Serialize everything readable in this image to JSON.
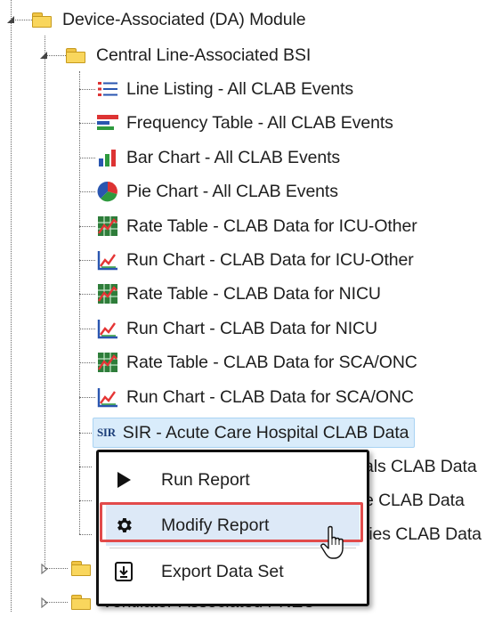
{
  "tree": {
    "da_module": "Device-Associated (DA) Module",
    "clab_folder": "Central Line-Associated BSI",
    "reports": [
      {
        "label": "Line Listing - All CLAB Events",
        "icon": "line-listing-icon"
      },
      {
        "label": "Frequency Table - All CLAB Events",
        "icon": "frequency-table-icon"
      },
      {
        "label": "Bar Chart - All CLAB Events",
        "icon": "bar-chart-icon"
      },
      {
        "label": "Pie Chart - All CLAB Events",
        "icon": "pie-chart-icon"
      },
      {
        "label": "Rate Table - CLAB Data for ICU-Other",
        "icon": "rate-table-icon"
      },
      {
        "label": "Run Chart - CLAB Data for ICU-Other",
        "icon": "run-chart-icon"
      },
      {
        "label": "Rate Table - CLAB Data for NICU",
        "icon": "rate-table-icon"
      },
      {
        "label": "Run Chart - CLAB Data for NICU",
        "icon": "run-chart-icon"
      },
      {
        "label": "Rate Table - CLAB Data for SCA/ONC",
        "icon": "rate-table-icon"
      },
      {
        "label": "Run Chart - CLAB Data for SCA/ONC",
        "icon": "run-chart-icon"
      }
    ],
    "selected_report": {
      "badge": "SIR",
      "label": "SIR - Acute Care Hospital CLAB Data"
    },
    "partial_reports": [
      "als CLAB Data",
      "e CLAB Data",
      "ties CLAB Data"
    ],
    "vap_folder": "Ventilator-Associated PNEU"
  },
  "context_menu": {
    "run": "Run Report",
    "modify": "Modify Report",
    "export": "Export Data Set"
  },
  "colors": {
    "selection": "#d9ecfb",
    "highlight_box": "#e24b4b",
    "menu_border": "#111111"
  }
}
